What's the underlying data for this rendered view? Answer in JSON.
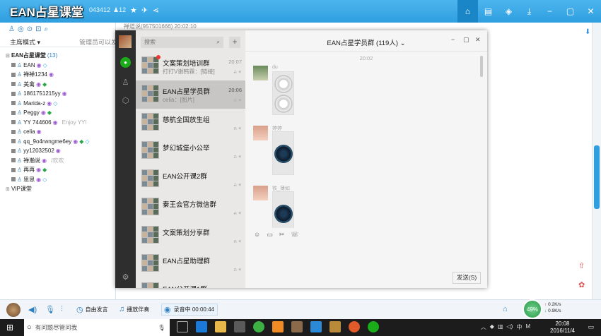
{
  "yy": {
    "title": "EAN占星课堂",
    "channel_id": "043412",
    "fans": "12",
    "mode": "主席模式",
    "admin_note": "管理员可以发言",
    "channel_path": "禅道说(957501666) 20:02:10",
    "tree": [
      {
        "name": "EAN占星课堂",
        "count": "(13)",
        "type": "channel"
      },
      {
        "name": "EAN",
        "type": "user"
      },
      {
        "name": "禅禅1234",
        "type": "user"
      },
      {
        "name": "美禽",
        "type": "user"
      },
      {
        "name": "1861751215yy",
        "type": "user"
      },
      {
        "name": "Marida-z",
        "type": "user"
      },
      {
        "name": "Peggy",
        "type": "user"
      },
      {
        "name": "YY 744606",
        "extra": "Enjoy YY!",
        "type": "user"
      },
      {
        "name": "celia",
        "type": "user"
      },
      {
        "name": "qq_9o4rwngme6ey",
        "type": "user"
      },
      {
        "name": "yy12032502",
        "type": "user"
      },
      {
        "name": "禅瀚说",
        "extra": "/欢欢",
        "type": "user"
      },
      {
        "name": "再再",
        "type": "user"
      },
      {
        "name": "思思",
        "type": "user"
      },
      {
        "name": "VIP课堂",
        "type": "sub"
      }
    ],
    "bottom": {
      "free_speak": "自由发言",
      "play_music": "播放伴奏",
      "recording": "录音中 00:00:44",
      "net_percent": "49%",
      "up": "0.2K/s",
      "down": "0.9K/s"
    }
  },
  "wechat": {
    "search_placeholder": "搜索",
    "chat_title": "EAN占星学员群 (119人)",
    "time_divider": "20:02",
    "send_label": "发送(S)",
    "chats": [
      {
        "name": "文案策划培训群",
        "preview": "打打V谢韩霖：[链接]",
        "time": "20:07",
        "unread": true,
        "selected": false
      },
      {
        "name": "EAN占星学员群",
        "preview": "celia：[图片]",
        "time": "20:06",
        "unread": false,
        "selected": true
      },
      {
        "name": "慈航全国放生组",
        "preview": "",
        "time": "",
        "unread": false,
        "selected": false
      },
      {
        "name": "梦幻城堡小公举",
        "preview": "",
        "time": "",
        "unread": false,
        "selected": false
      },
      {
        "name": "EAN公开课2群",
        "preview": "",
        "time": "",
        "unread": false,
        "selected": false
      },
      {
        "name": "秦王会官方微信群",
        "preview": "",
        "time": "",
        "unread": false,
        "selected": false
      },
      {
        "name": "文案策划分享群",
        "preview": "",
        "time": "",
        "unread": false,
        "selected": false
      },
      {
        "name": "EAN占星助理群",
        "preview": "",
        "time": "",
        "unread": false,
        "selected": false
      },
      {
        "name": "EAN公开课1群",
        "preview": "",
        "time": "",
        "unread": false,
        "selected": false
      }
    ],
    "messages": [
      {
        "sender": "du",
        "image": "light"
      },
      {
        "sender": "婷婷",
        "image": "dark"
      },
      {
        "sender": "铁_薄如",
        "image": "dark"
      }
    ]
  },
  "taskbar": {
    "search_placeholder": "有问题尽管问我",
    "ime": "中",
    "ime_mode": "M",
    "time": "20:08",
    "date": "2016/11/4"
  }
}
